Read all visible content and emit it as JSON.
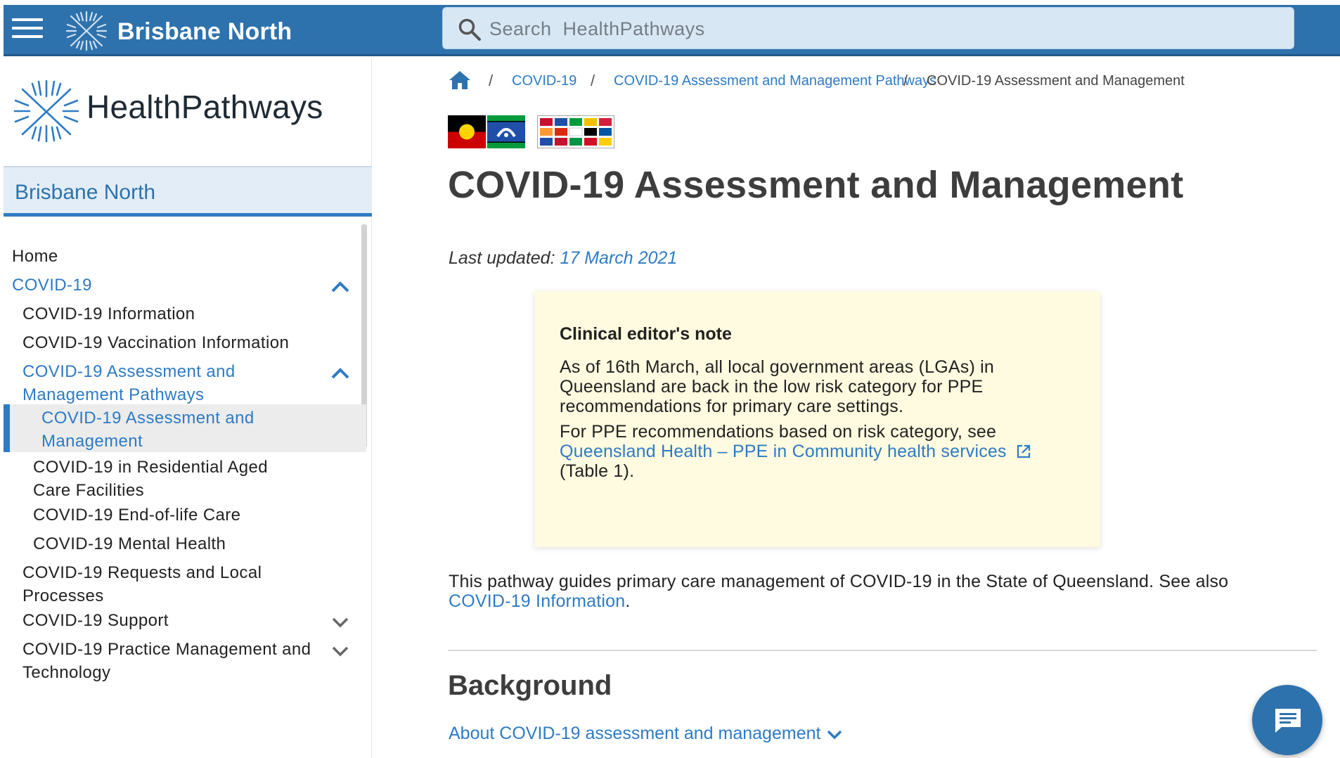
{
  "header": {
    "region_title": "Brisbane North",
    "search_placeholder": "Search  HealthPathways"
  },
  "sidebar": {
    "brand": "HealthPathways",
    "region": "Brisbane North",
    "items": [
      {
        "label": "Home"
      },
      {
        "label": "COVID-19"
      },
      {
        "label": "COVID-19 Information"
      },
      {
        "label": "COVID-19 Vaccination Information"
      },
      {
        "label": "COVID-19 Assessment and Management Pathways"
      },
      {
        "label": "COVID-19 Assessment and Management"
      },
      {
        "label": "COVID-19 in Residential Aged Care Facilities"
      },
      {
        "label": "COVID-19 End-of-life Care"
      },
      {
        "label": "COVID-19 Mental Health"
      },
      {
        "label": "COVID-19 Requests and Local Processes"
      },
      {
        "label": "COVID-19 Support"
      },
      {
        "label": "COVID-19 Practice Management and Technology"
      }
    ]
  },
  "breadcrumb": {
    "items": [
      "COVID-19",
      "COVID-19 Assessment and Management Pathways",
      "COVID-19 Assessment and Management"
    ],
    "separator": "/"
  },
  "page": {
    "title": "COVID-19 Assessment and Management",
    "last_updated_label": "Last updated:",
    "last_updated_date": "17 March 2021",
    "note": {
      "title": "Clinical editor's note",
      "p1_line1": "As of 16th March, all local government areas (LGAs) in",
      "p1_line2": "Queensland are back in the low risk category for PPE",
      "p1_line3": "recommendations for primary care settings.",
      "p2_line1": "For PPE recommendations based on risk category, see",
      "p2_link": "Queensland Health – PPE in Community health services",
      "p2_line3": "(Table 1)."
    },
    "intro_line1": "This pathway guides primary care management of COVID-19 in the State of Queensland. See also",
    "intro_link": "COVID-19 Information",
    "intro_end": ".",
    "section_heading": "Background",
    "expander_label": "About COVID-19 assessment and management"
  },
  "colors": {
    "primary": "#2e72ad",
    "link": "#2e7bc4",
    "note_bg": "#fffbe0"
  },
  "icons": [
    "hamburger-icon",
    "healthpathways-logo",
    "search-icon",
    "home-icon",
    "chevron-up-icon",
    "chevron-down-icon",
    "external-link-icon",
    "chat-icon"
  ]
}
